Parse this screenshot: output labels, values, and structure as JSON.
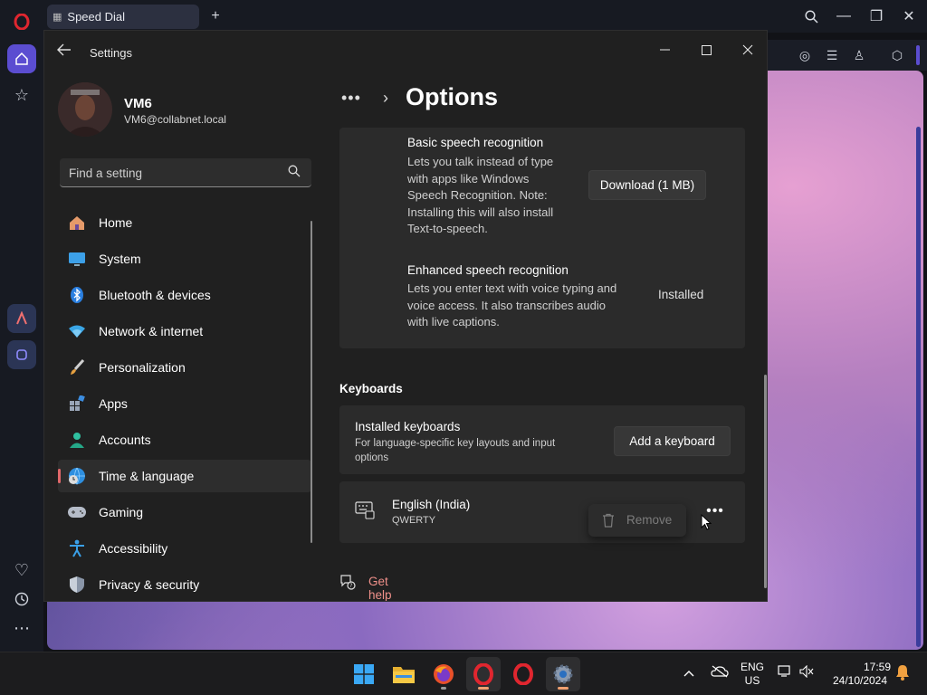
{
  "browser": {
    "tab_title": "Speed Dial",
    "new_tab_icon": "plus-icon",
    "sidebar_icons": [
      "opera-logo-icon",
      "home-icon",
      "star-icon",
      "aria-icon",
      "music-icon",
      "heart-icon",
      "history-icon",
      "more-icon"
    ]
  },
  "window": {
    "title": "Settings",
    "controls": [
      "minimize",
      "maximize",
      "close"
    ]
  },
  "profile": {
    "name": "VM6",
    "email": "VM6@collabnet.local"
  },
  "search": {
    "placeholder": "Find a setting"
  },
  "nav": {
    "items": [
      {
        "label": "Home",
        "icon": "home-icon"
      },
      {
        "label": "System",
        "icon": "system-icon"
      },
      {
        "label": "Bluetooth & devices",
        "icon": "bluetooth-icon"
      },
      {
        "label": "Network & internet",
        "icon": "wifi-icon"
      },
      {
        "label": "Personalization",
        "icon": "brush-icon"
      },
      {
        "label": "Apps",
        "icon": "apps-icon"
      },
      {
        "label": "Accounts",
        "icon": "account-icon"
      },
      {
        "label": "Time & language",
        "icon": "globe-clock-icon",
        "selected": true
      },
      {
        "label": "Gaming",
        "icon": "gamepad-icon"
      },
      {
        "label": "Accessibility",
        "icon": "accessibility-icon"
      },
      {
        "label": "Privacy & security",
        "icon": "shield-icon"
      }
    ]
  },
  "breadcrumb": {
    "dots": "•••",
    "title": "Options"
  },
  "speech": {
    "basic": {
      "title": "Basic speech recognition",
      "desc_lines": [
        "Lets you talk instead of type",
        "with apps like Windows",
        "Speech Recognition. Note:",
        "Installing this will also install",
        "Text-to-speech."
      ],
      "button": "Download (1 MB)"
    },
    "enhanced": {
      "title": "Enhanced speech recognition",
      "desc_lines": [
        "Lets you enter text with voice typing and",
        "voice access. It also transcribes audio",
        "with live captions."
      ],
      "status": "Installed"
    }
  },
  "keyboards": {
    "heading": "Keyboards",
    "installed_title": "Installed keyboards",
    "installed_desc_lines": [
      "For language-specific key layouts and input",
      "options"
    ],
    "add_button": "Add a keyboard",
    "item": {
      "name": "English (India)",
      "layout": "QWERTY"
    },
    "context_menu": {
      "remove": "Remove"
    }
  },
  "help": {
    "label": "Get help"
  },
  "taskbar": {
    "apps": [
      "windows-start-icon",
      "file-explorer-icon",
      "firefox-icon",
      "opera-icon",
      "opera-icon",
      "settings-gear-icon"
    ],
    "lang_line1": "ENG",
    "lang_line2": "US",
    "time": "17:59",
    "date": "24/10/2024"
  },
  "colors": {
    "accent": "#e0686a",
    "link": "#f0908a",
    "window_bg": "#202020",
    "card_bg": "#2b2b2b"
  }
}
